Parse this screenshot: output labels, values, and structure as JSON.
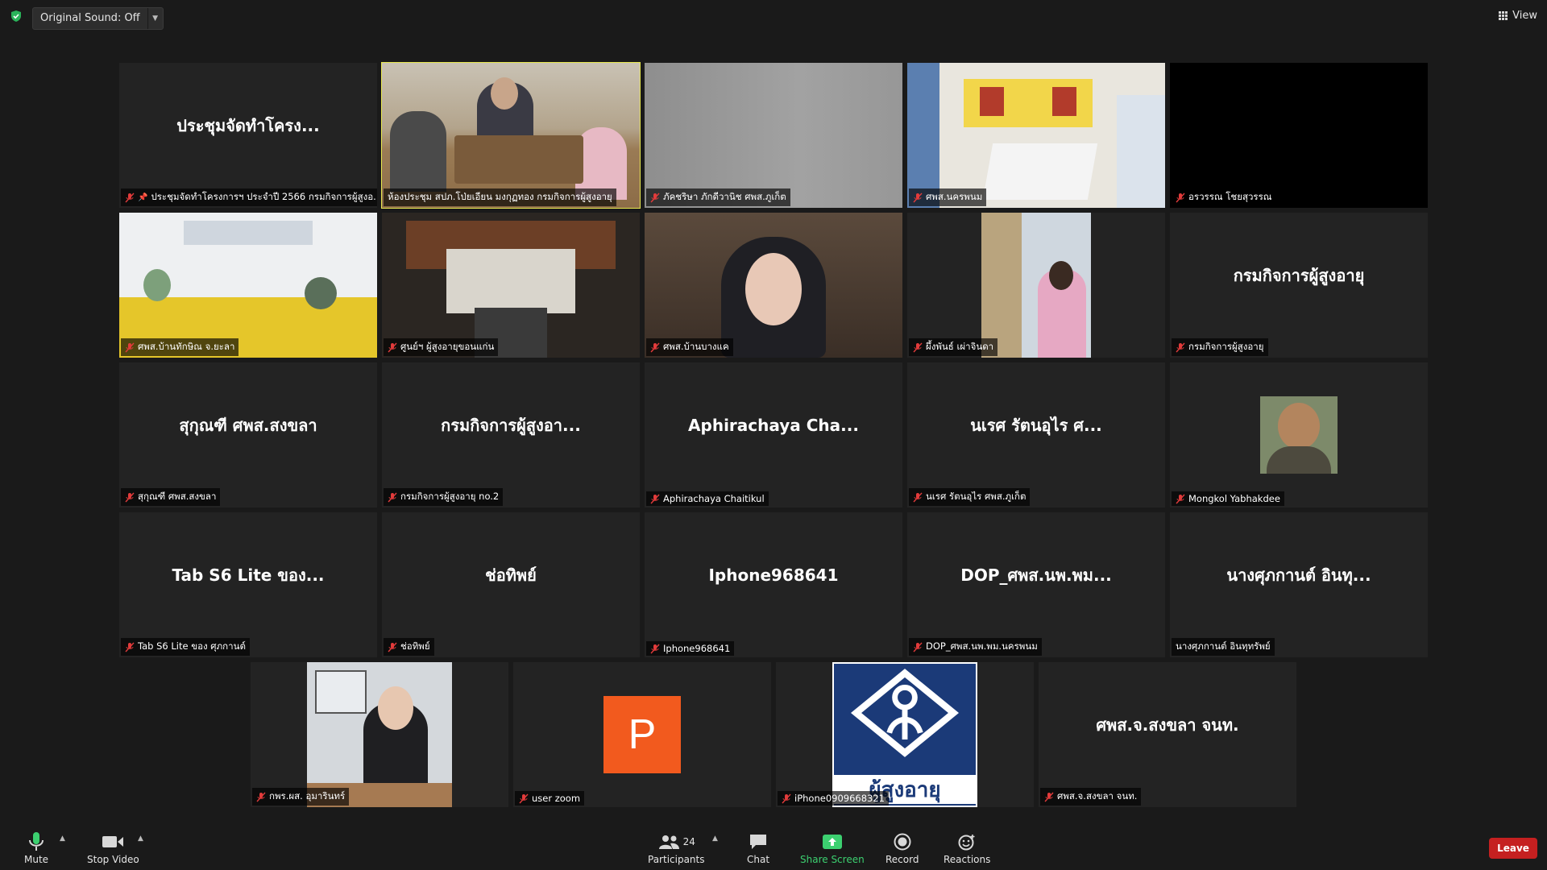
{
  "topbar": {
    "original_sound": "Original Sound: Off",
    "view_label": "View"
  },
  "tiles": [
    {
      "big": "ประชุมจัดทำโครง...",
      "name": "ประชุมจัดทำโครงการฯ ประจำปี 2566 กรมกิจการผู้สูงอ..."
    },
    {
      "big": "",
      "name": "ห้องประชุม สปภ.โป่ยเอียน มงกุฏทอง กรมกิจการผู้สูงอายุ"
    },
    {
      "big": "",
      "name": "ภัคชริษา ภักดีวานิช ศพส.ภูเก็ต"
    },
    {
      "big": "",
      "name": "ศพส.นครพนม"
    },
    {
      "big": "",
      "name": "อรวรรณ โชยสุวรรณ"
    },
    {
      "big": "",
      "name": "ศพส.บ้านทักษิณ จ.ยะลา"
    },
    {
      "big": "",
      "name": "ศูนย์ฯ ผู้สูงอายุขอนแก่น"
    },
    {
      "big": "",
      "name": "ศพส.บ้านบางแค"
    },
    {
      "big": "",
      "name": "ผึ้งพันธ์ เผ่าจินดา"
    },
    {
      "big": "กรมกิจการผู้สูงอายุ",
      "name": "กรมกิจการผู้สูงอายุ"
    },
    {
      "big": "สุกุณฑี ศพส.สงขลา",
      "name": "สุกุณฑี ศพส.สงขลา"
    },
    {
      "big": "กรมกิจการผู้สูงอา...",
      "name": "กรมกิจการผู้สูงอายุ no.2"
    },
    {
      "big": "Aphirachaya Cha...",
      "name": "Aphirachaya Chaitikul"
    },
    {
      "big": "นเรศ รัตนอุไร ศ...",
      "name": "นเรศ รัตนอุไร ศพส.ภูเก็ต"
    },
    {
      "big": "",
      "name": "Mongkol Yabhakdee"
    },
    {
      "big": "Tab S6 Lite ของ...",
      "name": "Tab S6 Lite ของ ศุภกานต์"
    },
    {
      "big": "ช่อทิพย์",
      "name": "ช่อทิพย์"
    },
    {
      "big": "Iphone968641",
      "name": "Iphone968641"
    },
    {
      "big": "DOP_ศพส.นพ.พม...",
      "name": "DOP_ศพส.นพ.พม.นครพนม"
    },
    {
      "big": "นางศุภกานต์ อินทุ...",
      "name": "นางศุภกานต์ อินทุทรัพย์"
    },
    {
      "big": "",
      "name": "กพร.ผส. อุมารินทร์"
    },
    {
      "big": "",
      "name": "user zoom",
      "avatar_letter": "P"
    },
    {
      "big": "",
      "name": "iPhone0909668321",
      "logo_text": "ผู้สูงอายุ"
    },
    {
      "big": "ศพส.จ.สงขลา จนท.",
      "name": "ศพส.จ.สงขลา จนท."
    }
  ],
  "toolbar": {
    "mute": "Mute",
    "stop_video": "Stop Video",
    "participants": "Participants",
    "participant_count": "24",
    "chat": "Chat",
    "share_screen": "Share Screen",
    "record": "Record",
    "reactions": "Reactions",
    "leave": "Leave"
  }
}
